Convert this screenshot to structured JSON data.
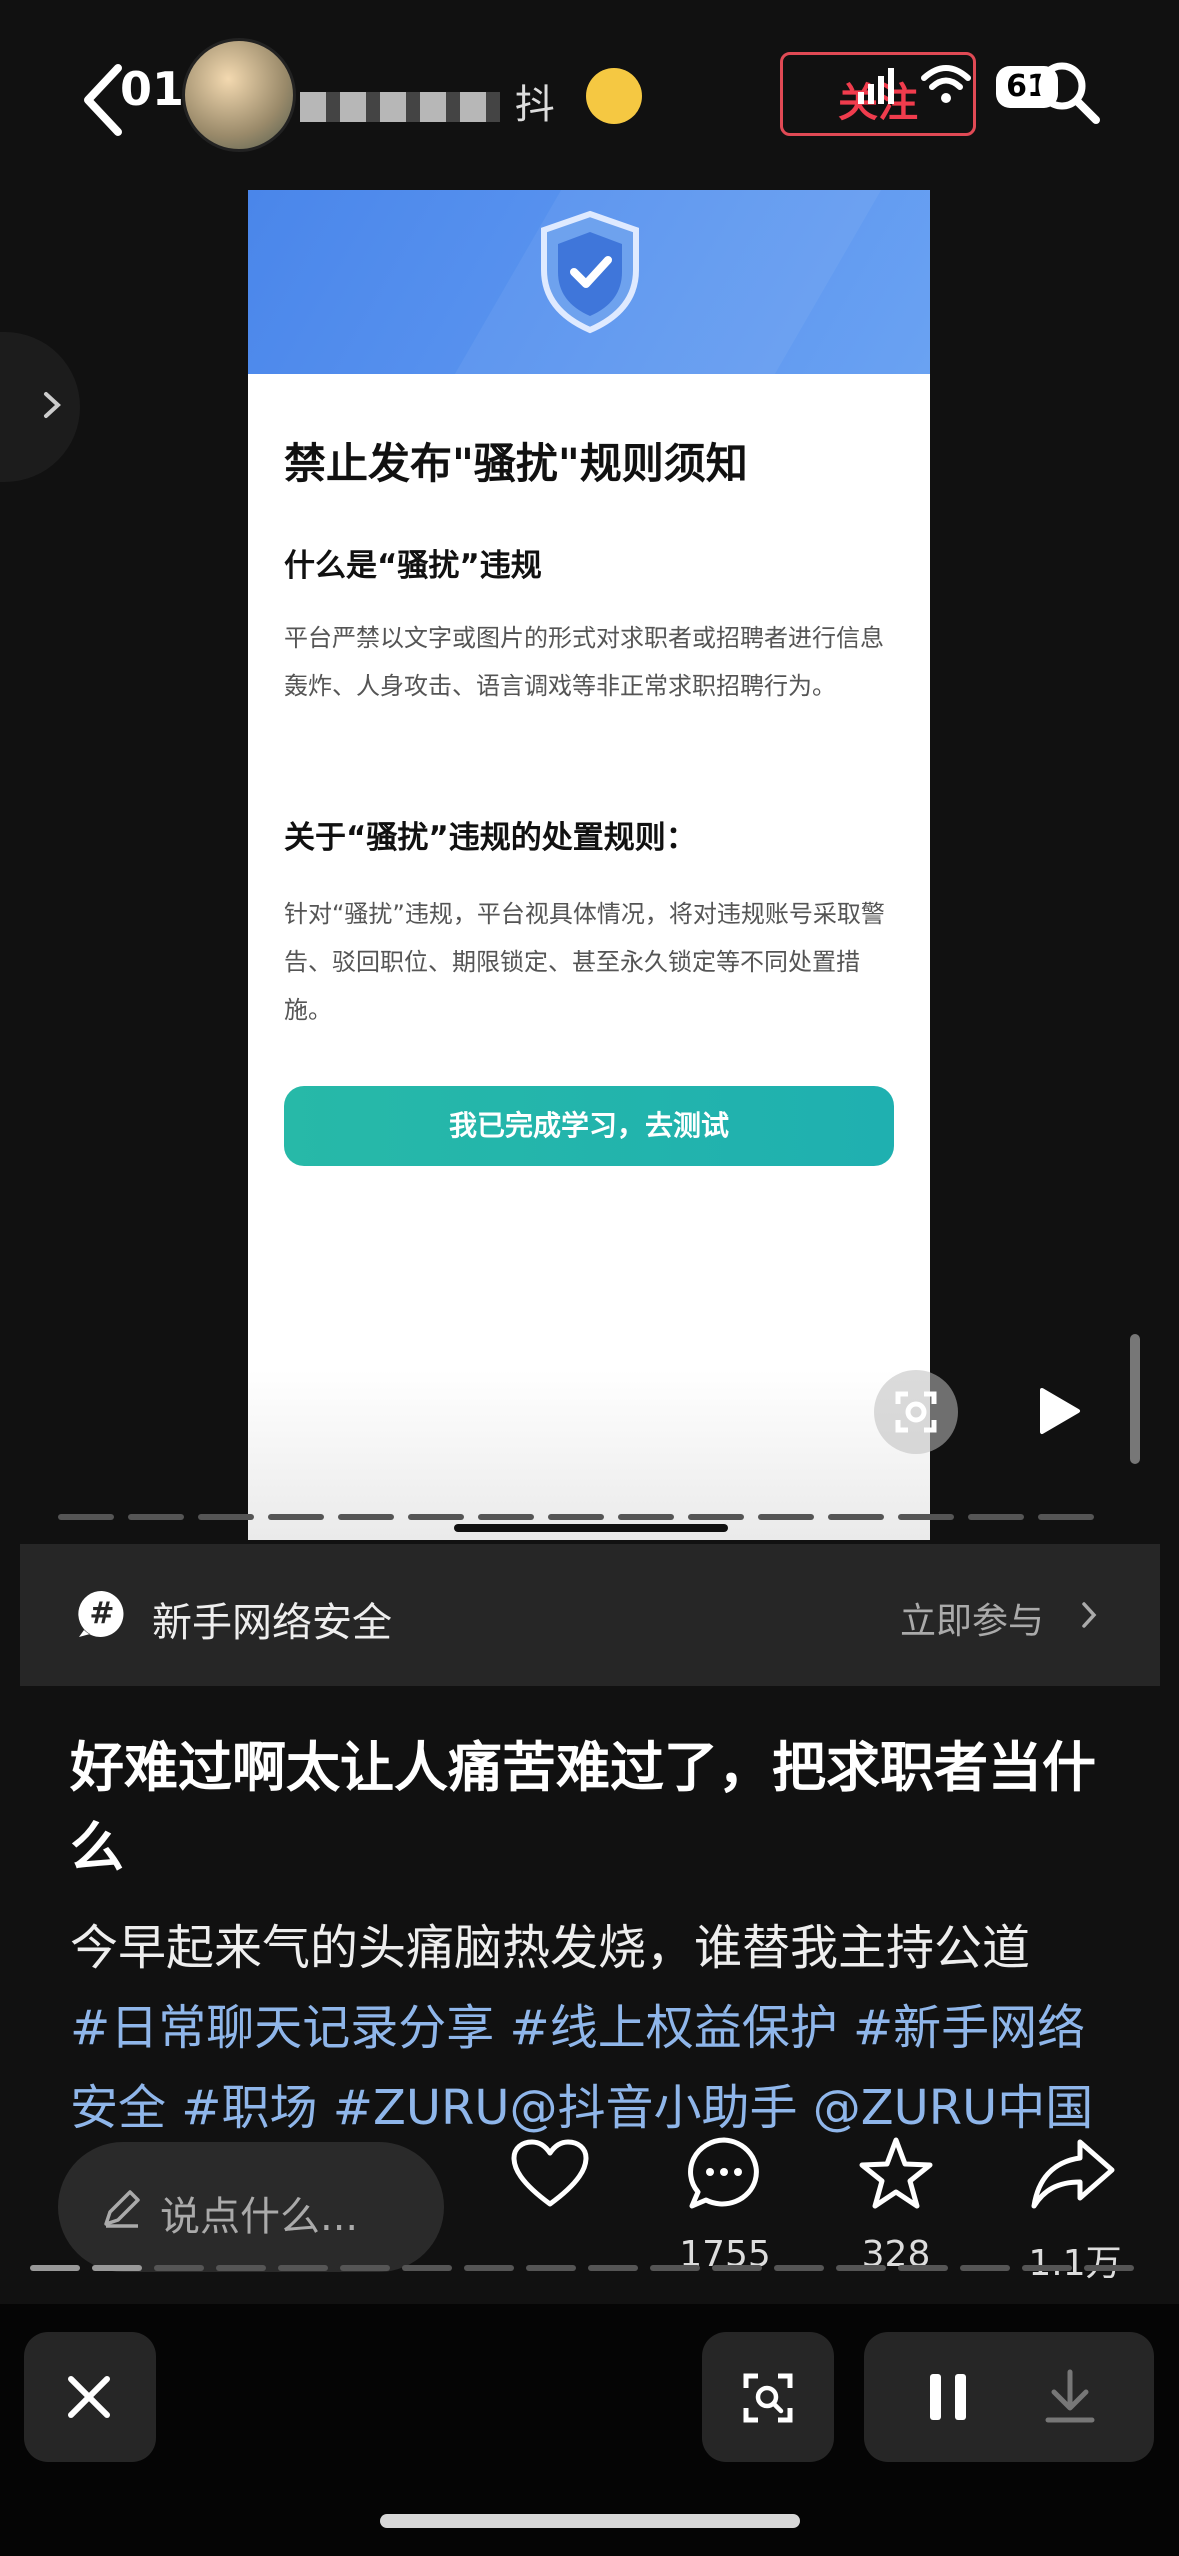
{
  "status_bar": {
    "time": "01:46",
    "battery": "61"
  },
  "author": {
    "name_visible": "抖",
    "follow_label": "关注"
  },
  "embedded_screenshot": {
    "title": "禁止发布\"骚扰\"规则须知",
    "section1_heading": "什么是“骚扰”违规",
    "section1_body": "平台严禁以文字或图片的形式对求职者或招聘者进行信息轰炸、人身攻击、语言调戏等非正常求职招聘行为。",
    "section2_heading": "关于“骚扰”违规的处置规则：",
    "section2_body": "针对“骚扰”违规，平台视具体情况，将对违规账号采取警告、驳回职位、期限锁定、甚至永久锁定等不同处置措施。",
    "button_label": "我已完成学习，去测试"
  },
  "topic": {
    "name": "新手网络安全",
    "join_label": "立即参与"
  },
  "caption": {
    "title": "好难过啊太让人痛苦难过了，把求职者当什么",
    "body": "今早起来气的头痛脑热发烧，谁替我主持公道",
    "tags": "#日常聊天记录分享 #线上权益保护 #新手网络安全 #职场 #ZURU@抖音小助手 @ZURU中国"
  },
  "comment_input": {
    "placeholder": "说点什么..."
  },
  "actions": {
    "likes": "",
    "comments": "1755",
    "favorites": "328",
    "shares": "1.1万"
  },
  "colors": {
    "accent_follow": "#f03c4d",
    "tag_blue": "#8fb6ea",
    "button_teal": "#1fb0b0",
    "header_blue": "#4a86ea"
  },
  "icons": [
    "back-icon",
    "search-icon",
    "shield-icon",
    "scan-icon",
    "play-icon",
    "hash-icon",
    "chevron-right-icon",
    "pencil-icon",
    "heart-icon",
    "comment-icon",
    "star-icon",
    "share-icon",
    "close-icon",
    "pause-icon",
    "download-icon"
  ]
}
